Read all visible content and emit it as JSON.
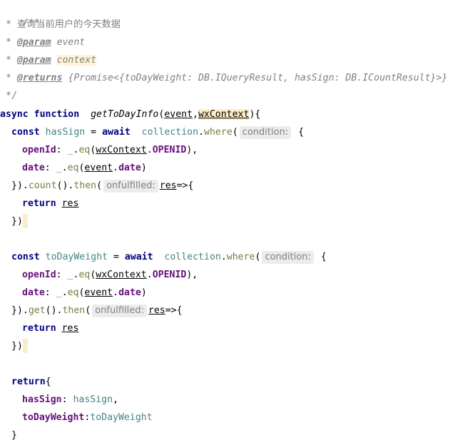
{
  "doc_comment": {
    "open": "/**",
    "star": "*",
    "description": "查询当前用户的今天数据",
    "param_tag": "@param",
    "param1": "event",
    "param2": "context",
    "returns_tag": "@returns",
    "returns_type": "{Promise<{toDayWeight: DB.IQueryResult, hasSign: DB.ICountResult}>}",
    "close": "*/"
  },
  "signature": {
    "async_kw": "async",
    "function_kw": "function",
    "name": "getToDayInfo",
    "open_paren": "(",
    "p1": "event",
    "comma": ",",
    "p2": "wxContext",
    "close": "){"
  },
  "block1": {
    "const_kw": "const",
    "var_name": "hasSign",
    "eq_await": " = ",
    "await_kw": "await",
    "collection": "collection",
    "dot": ".",
    "where": "where",
    "lparen": "(",
    "hint_condition": "condition:",
    "lbrace": "{",
    "openid_key": "openId",
    "colon": ": ",
    "underscore": "_",
    "eq": "eq",
    "wxctx": "wxContext",
    "openid_prop": "OPENID",
    "tail_comma": "),",
    "date_key": "date",
    "event": "event",
    "date_prop": "date",
    "tail_paren": ")",
    "close_chain": "}).",
    "method1": "count",
    "mid": "().",
    "then": "then",
    "hint_onfulfilled": "onfulfilled:",
    "res": "res",
    "arrow": "=>{",
    "return_kw": "return",
    "close_cb": "})"
  },
  "block2": {
    "const_kw": "const",
    "var_name": "toDayWeight",
    "method1": "get"
  },
  "final_return": {
    "return_kw": "return",
    "open": "{",
    "key1": "hasSign",
    "val1": "hasSign",
    "key2": "toDayWeight",
    "val2": "toDayWeight",
    "close": "}"
  }
}
